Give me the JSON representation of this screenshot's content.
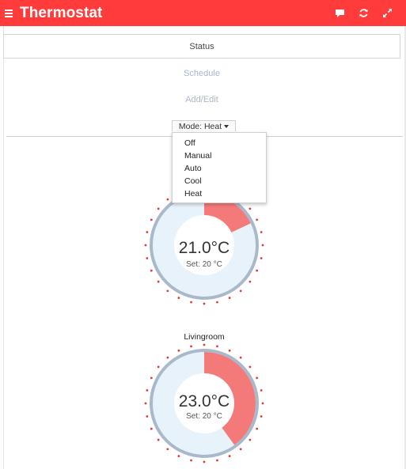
{
  "app": {
    "title": "Thermostat",
    "accent": "#ff3b3b",
    "icons": [
      "menu-icon",
      "chat-icon",
      "refresh-icon",
      "fullscreen-icon"
    ]
  },
  "tabs": {
    "status": "Status",
    "schedule": "Schedule",
    "add_edit": "Add/Edit"
  },
  "mode": {
    "label": "Mode: Heat",
    "options": [
      "Off",
      "Manual",
      "Auto",
      "Cool",
      "Heat"
    ]
  },
  "zones": [
    {
      "name": "",
      "temperature": "21.0°C",
      "setpoint": "Set: 20 °C",
      "fill_fraction": 0.18
    },
    {
      "name": "Livingroom",
      "temperature": "23.0°C",
      "setpoint": "Set: 20 °C",
      "fill_fraction": 0.4
    }
  ],
  "colors": {
    "gauge_fill": "#f47a7a",
    "gauge_track": "#e8f2fa",
    "gauge_ring": "#a9b9c9",
    "tick": "#e03a3a"
  }
}
